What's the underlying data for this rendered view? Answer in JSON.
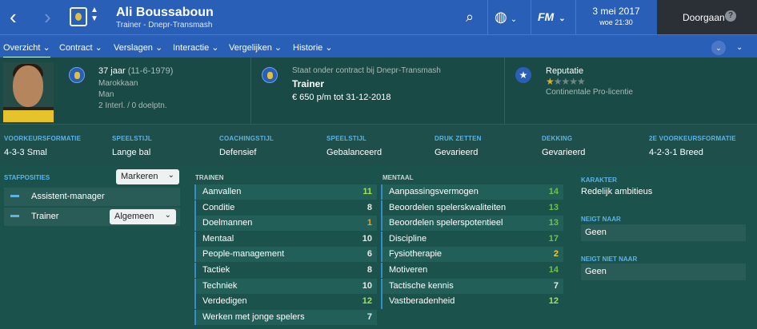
{
  "header": {
    "player_name": "Ali Boussaboun",
    "player_subtitle": "Trainer - Dnepr-Transmash",
    "date": "3 mei 2017",
    "day_time": "woe 21:30",
    "continue_label": "Doorgaan",
    "fm_logo": "FM",
    "icons": [
      "back-arrow-icon",
      "forward-arrow-icon",
      "club-crest-icon",
      "up-down-icon",
      "search-icon",
      "globe-icon",
      "fm-menu-icon",
      "help-icon"
    ]
  },
  "tabs": [
    {
      "label": "Overzicht"
    },
    {
      "label": "Contract"
    },
    {
      "label": "Verslagen"
    },
    {
      "label": "Interactie"
    },
    {
      "label": "Vergelijken"
    },
    {
      "label": "Historie"
    }
  ],
  "profile": {
    "age": "37 jaar",
    "birthdate": "(11-6-1979)",
    "nationality": "Marokkaan",
    "gender": "Man",
    "caps": "2 Interl. / 0 doelptn.",
    "contract_label": "Staat onder contract bij Dnepr-Transmash",
    "role": "Trainer",
    "salary": "€ 650 p/m tot 31-12-2018",
    "reputation_label": "Reputatie",
    "reputation_stars": 1,
    "reputation_max": 5,
    "license": "Continentale Pro-licentie"
  },
  "tactics": [
    {
      "label": "VOORKEURSFORMATIE",
      "value": "4-3-3 Smal"
    },
    {
      "label": "SPEELSTIJL",
      "value": "Lange bal"
    },
    {
      "label": "COACHINGSTIJL",
      "value": "Defensief"
    },
    {
      "label": "SPEELSTIJL",
      "value": "Gebalanceerd"
    },
    {
      "label": "DRUK ZETTEN",
      "value": "Gevarieerd"
    },
    {
      "label": "DEKKING",
      "value": "Gevarieerd"
    },
    {
      "label": "2E VOORKEURSFORMATIE",
      "value": "4-2-3-1 Breed"
    }
  ],
  "staff_positions": {
    "heading": "STAFPOSITIES",
    "mark_button": "Markeren",
    "roles": [
      {
        "label": "Assistent-manager"
      },
      {
        "label": "Trainer",
        "dropdown": "Algemeen"
      }
    ]
  },
  "training": {
    "heading": "TRAINEN",
    "attributes": [
      {
        "name": "Aanvallen",
        "value": 11,
        "color": "#a0e05a"
      },
      {
        "name": "Conditie",
        "value": 8,
        "color": "#e8e8e8"
      },
      {
        "name": "Doelmannen",
        "value": 1,
        "color": "#e8a030"
      },
      {
        "name": "Mentaal",
        "value": 10,
        "color": "#e8e8e8"
      },
      {
        "name": "People-management",
        "value": 6,
        "color": "#e8e8e8"
      },
      {
        "name": "Tactiek",
        "value": 8,
        "color": "#e8e8e8"
      },
      {
        "name": "Techniek",
        "value": 10,
        "color": "#e8e8e8"
      },
      {
        "name": "Verdedigen",
        "value": 12,
        "color": "#a0e05a"
      },
      {
        "name": "Werken met jonge spelers",
        "value": 7,
        "color": "#e8e8e8"
      }
    ]
  },
  "mental": {
    "heading": "MENTAAL",
    "attributes": [
      {
        "name": "Aanpassingsvermogen",
        "value": 14,
        "color": "#6ec24a"
      },
      {
        "name": "Beoordelen spelerskwaliteiten",
        "value": 13,
        "color": "#6ec24a"
      },
      {
        "name": "Beoordelen spelerspotentieel",
        "value": 13,
        "color": "#6ec24a"
      },
      {
        "name": "Discipline",
        "value": 17,
        "color": "#6ec24a"
      },
      {
        "name": "Fysiotherapie",
        "value": 2,
        "color": "#e8cf3a"
      },
      {
        "name": "Motiveren",
        "value": 14,
        "color": "#6ec24a"
      },
      {
        "name": "Tactische kennis",
        "value": 7,
        "color": "#e8e8e8"
      },
      {
        "name": "Vastberadenheid",
        "value": 12,
        "color": "#a0e05a"
      }
    ]
  },
  "character": {
    "heading": "KARAKTER",
    "value": "Redelijk ambitieus",
    "tends_heading": "NEIGT NAAR",
    "tends_value": "Geen",
    "not_tends_heading": "NEIGT NIET NAAR",
    "not_tends_value": "Geen"
  }
}
